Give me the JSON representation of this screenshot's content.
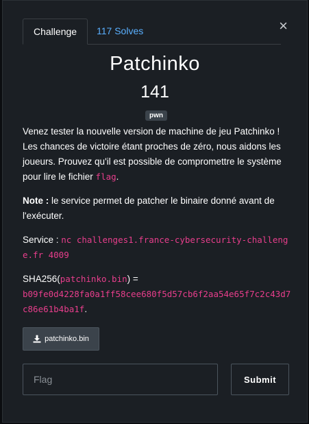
{
  "tabs": [
    {
      "label": "Challenge"
    },
    {
      "label": "117 Solves"
    }
  ],
  "close_label": "×",
  "challenge": {
    "name": "Patchinko",
    "points": "141",
    "tag": "pwn"
  },
  "description": {
    "p1_text": "Venez tester la nouvelle version de machine de jeu Patchinko ! Les chances de victoire étant proches de zéro, nous aidons les joueurs. Prouvez qu'il est possible de compromettre le système pour lire le fichier ",
    "p1_code": "flag",
    "p1_end": ".",
    "note_label": "Note :",
    "note_text": " le service permet de patcher le binaire donné avant de l'exécuter.",
    "service_label": "Service : ",
    "service_code": "nc challenges1.france-cybersecurity-challenge.fr 4009",
    "sha_prefix": "SHA256(",
    "sha_file": "patchinko.bin",
    "sha_mid": ") =",
    "sha_hash": "b09fe0d4228fa0a1ff58cee680f5d57cb6f2aa54e65f7c2c43d7c86e61b4ba1f",
    "sha_end": "."
  },
  "download": {
    "label": "patchinko.bin",
    "icon": "download-icon"
  },
  "form": {
    "flag_placeholder": "Flag",
    "flag_value": "",
    "submit_label": "Submit"
  },
  "colors": {
    "background": "#1b1f24",
    "accent_link": "#5ab0ff",
    "code": "#e83e8c",
    "tag_bg": "#3b434b"
  }
}
